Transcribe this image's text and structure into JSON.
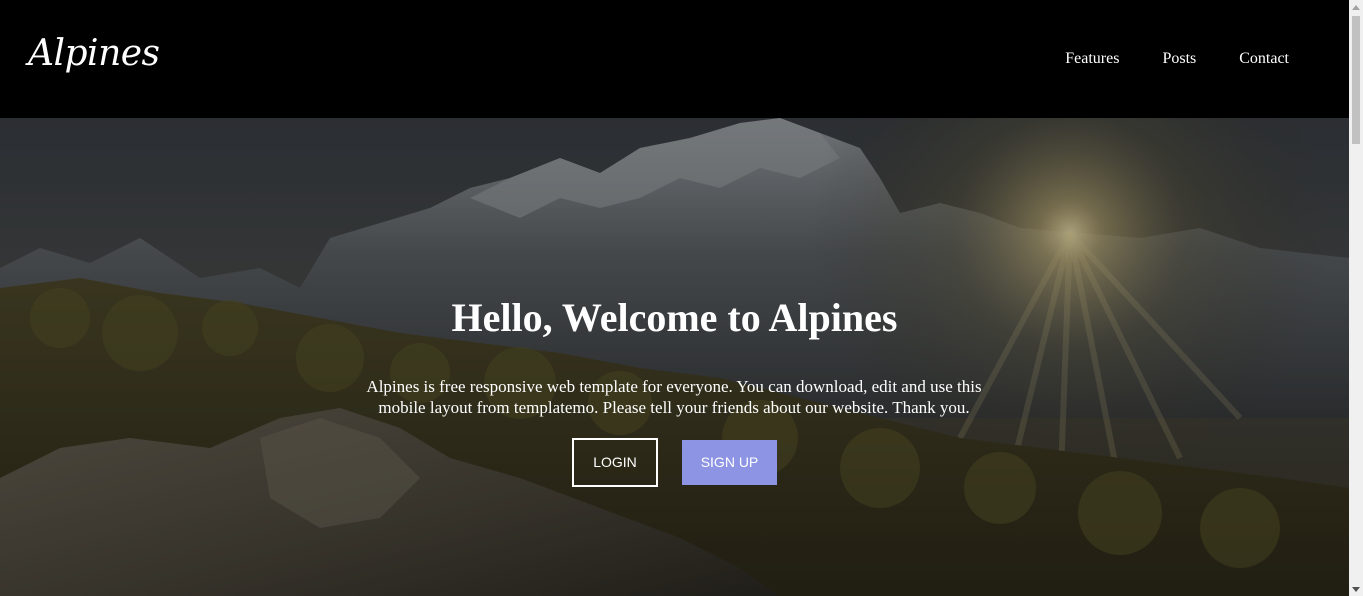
{
  "header": {
    "logo": "Alpines",
    "nav": [
      {
        "label": "Features"
      },
      {
        "label": "Posts"
      },
      {
        "label": "Contact"
      }
    ]
  },
  "hero": {
    "title": "Hello, Welcome to Alpines",
    "text": "Alpines is free responsive web template for everyone. You can download, edit and use this mobile layout from templatemo. Please tell your friends about our website. Thank you.",
    "login_label": "LOGIN",
    "signup_label": "SIGN UP",
    "background_icon": "mountain-sunrise-image"
  },
  "colors": {
    "header_bg": "#000000",
    "signup_bg": "#8d94e4",
    "text": "#ffffff"
  }
}
